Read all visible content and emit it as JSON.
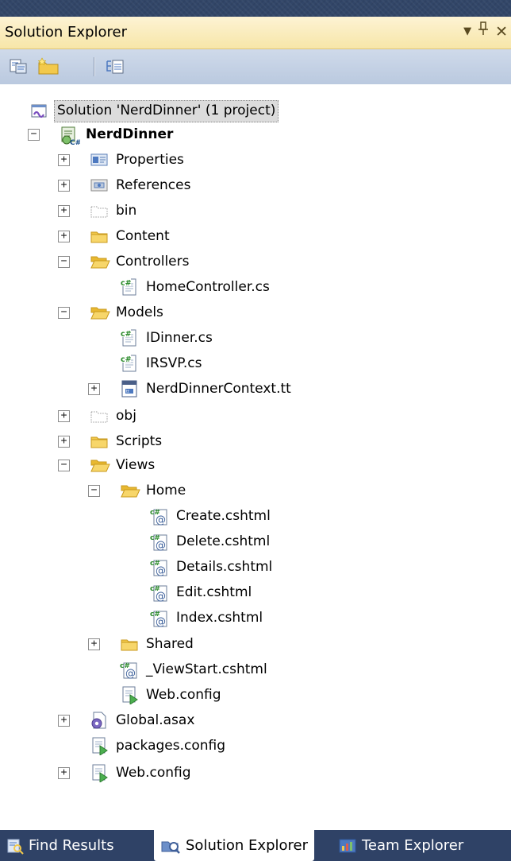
{
  "panel": {
    "title": "Solution Explorer",
    "dropdown_glyph": "▼",
    "pin_glyph": "Ⅎ",
    "close_glyph": "✕"
  },
  "toolbar": {
    "buttons": [
      {
        "name": "properties-button",
        "icon": "properties-icon"
      },
      {
        "name": "show-all-files-button",
        "icon": "new-folder-icon"
      },
      {
        "name": "view-class-diagram-button",
        "icon": "class-diagram-icon"
      }
    ]
  },
  "tree": {
    "items": [
      {
        "label": "Solution 'NerdDinner' (1 project)",
        "icon": "solution-icon",
        "expander": "",
        "selected": true
      },
      {
        "label": "NerdDinner",
        "icon": "csharp-project-icon",
        "expander": "−",
        "bold": true
      },
      {
        "label": "Properties",
        "icon": "properties-folder-icon",
        "expander": "+"
      },
      {
        "label": "References",
        "icon": "references-icon",
        "expander": "+"
      },
      {
        "label": "bin",
        "icon": "hidden-folder-icon",
        "expander": "+"
      },
      {
        "label": "Content",
        "icon": "folder-icon",
        "expander": "+"
      },
      {
        "label": "Controllers",
        "icon": "open-folder-icon",
        "expander": "−"
      },
      {
        "label": "HomeController.cs",
        "icon": "csharp-file-icon",
        "expander": ""
      },
      {
        "label": "Models",
        "icon": "open-folder-icon",
        "expander": "−"
      },
      {
        "label": "IDinner.cs",
        "icon": "csharp-file-icon",
        "expander": ""
      },
      {
        "label": "IRSVP.cs",
        "icon": "csharp-file-icon",
        "expander": ""
      },
      {
        "label": "NerdDinnerContext.tt",
        "icon": "template-file-icon",
        "expander": "+"
      },
      {
        "label": "obj",
        "icon": "hidden-folder-icon",
        "expander": "+"
      },
      {
        "label": "Scripts",
        "icon": "folder-icon",
        "expander": "+"
      },
      {
        "label": "Views",
        "icon": "open-folder-icon",
        "expander": "−"
      },
      {
        "label": "Home",
        "icon": "open-folder-icon",
        "expander": "−"
      },
      {
        "label": "Create.cshtml",
        "icon": "razor-file-icon",
        "expander": ""
      },
      {
        "label": "Delete.cshtml",
        "icon": "razor-file-icon",
        "expander": ""
      },
      {
        "label": "Details.cshtml",
        "icon": "razor-file-icon",
        "expander": ""
      },
      {
        "label": "Edit.cshtml",
        "icon": "razor-file-icon",
        "expander": ""
      },
      {
        "label": "Index.cshtml",
        "icon": "razor-file-icon",
        "expander": ""
      },
      {
        "label": "Shared",
        "icon": "folder-icon",
        "expander": "+"
      },
      {
        "label": "_ViewStart.cshtml",
        "icon": "razor-file-icon",
        "expander": ""
      },
      {
        "label": "Web.config",
        "icon": "config-file-icon",
        "expander": ""
      },
      {
        "label": "Global.asax",
        "icon": "global-asax-icon",
        "expander": "+"
      },
      {
        "label": "packages.config",
        "icon": "config-file-icon",
        "expander": ""
      },
      {
        "label": "Web.config",
        "icon": "config-file-icon",
        "expander": "+"
      }
    ]
  },
  "tabs": [
    {
      "label": "Find Results",
      "icon": "find-results-icon",
      "active": false
    },
    {
      "label": "Solution Explorer",
      "icon": "solution-explorer-icon",
      "active": true
    },
    {
      "label": "Team Explorer",
      "icon": "team-explorer-icon",
      "active": false
    }
  ],
  "colors": {
    "title_bar": "#f7e6a8",
    "toolbar": "#c4d1e4",
    "frame": "#324668",
    "selection": "#dcdcdc",
    "folder": "#f2c94c"
  }
}
